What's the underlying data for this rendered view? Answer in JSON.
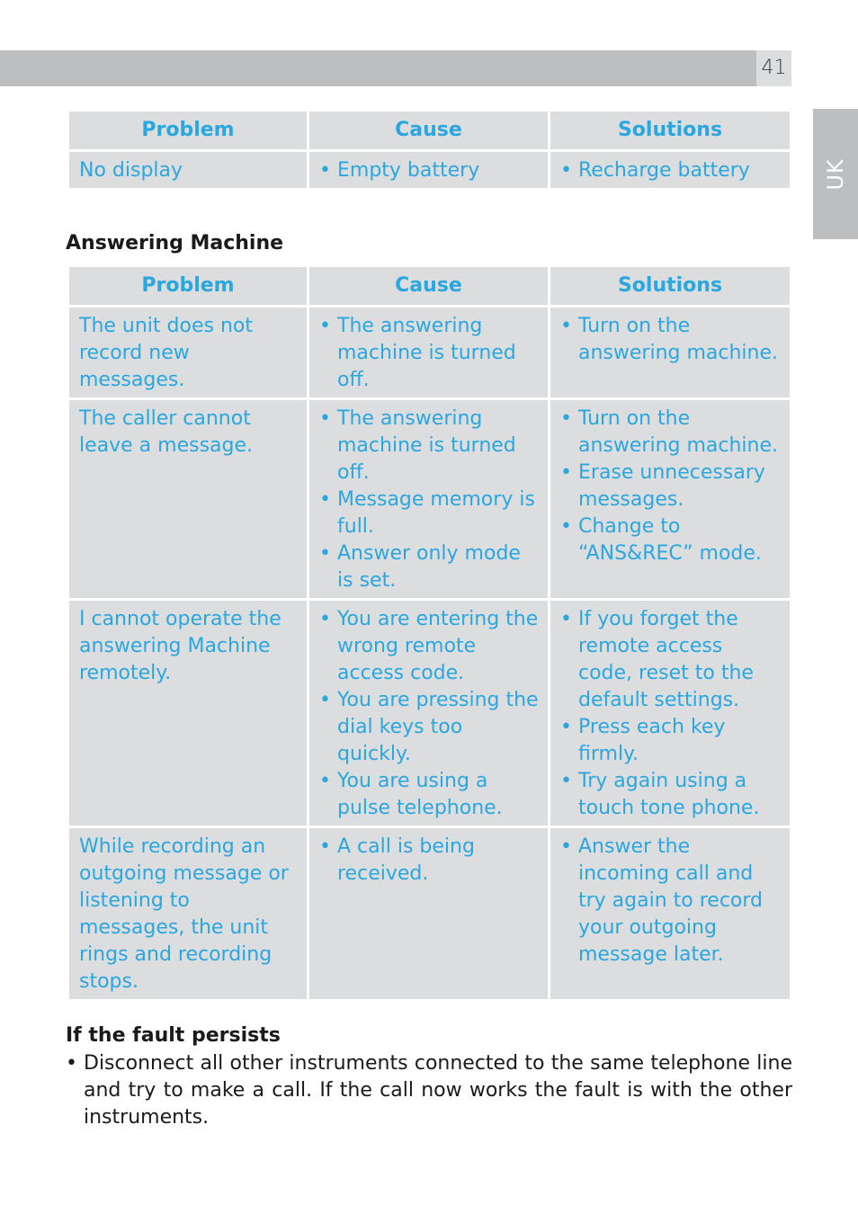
{
  "header": {
    "page_number": "41",
    "language_tab": "UK"
  },
  "display_table": {
    "columns": [
      "Problem",
      "Cause",
      "Solutions"
    ],
    "rows": [
      {
        "problem": "No display",
        "causes": [
          "Empty battery"
        ],
        "solutions": [
          "Recharge battery"
        ]
      }
    ]
  },
  "answering_machine": {
    "title": "Answering Machine",
    "columns": [
      "Problem",
      "Cause",
      "Solutions"
    ],
    "rows": [
      {
        "problem": "The unit does not record new messages.",
        "causes": [
          "The answering machine is turned off."
        ],
        "solutions": [
          "Turn on the answering machine."
        ]
      },
      {
        "problem": "The caller cannot leave a message.",
        "causes": [
          "The answering machine is turned off.",
          "Message memory is full.",
          "Answer only mode is set."
        ],
        "solutions": [
          "Turn on the answering machine.",
          "Erase unnecessary messages.",
          "Change to “ANS&REC” mode."
        ]
      },
      {
        "problem": "I cannot operate the answering Machine remotely.",
        "causes": [
          "You are entering the wrong remote access code.",
          "You are pressing the dial keys too quickly.",
          "You are using a pulse telephone."
        ],
        "solutions": [
          "If you forget the remote access code, reset to the default settings.",
          "Press each key firmly.",
          "Try again using a touch tone phone."
        ]
      },
      {
        "problem": "While recording an outgoing message or listening to messages, the unit rings and recording stops.",
        "causes": [
          "A call is being received."
        ],
        "solutions": [
          "Answer the incoming call and try again to record your outgoing message later."
        ]
      }
    ]
  },
  "fault_persists": {
    "title": "If the fault persists",
    "items": [
      "Disconnect all other instruments connected to the same telephone line and try to make a call. If the call now works the fault is with the other instruments."
    ]
  },
  "colors": {
    "accent": "#2aa7e0",
    "cell_bg": "#dcdddf",
    "bar_gray": "#bdbec0"
  }
}
